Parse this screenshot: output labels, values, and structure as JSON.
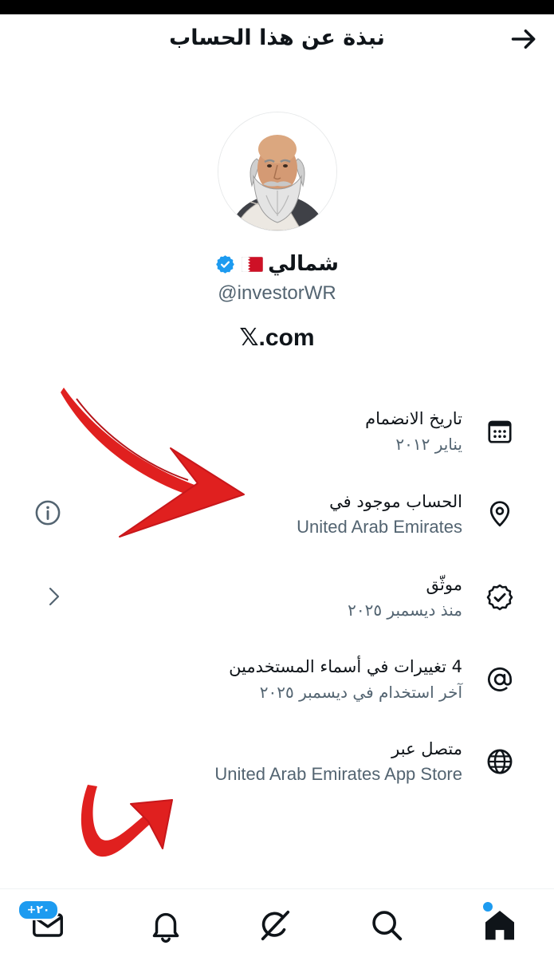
{
  "header": {
    "title": "نبذة عن هذا الحساب",
    "back_icon": "arrow-right-icon"
  },
  "profile": {
    "avatar_icon": "socrates-avatar-image",
    "name": "شمالي",
    "flag_icon": "bahrain-flag-icon",
    "verified_icon": "verified-badge-icon",
    "handle": "@investorWR",
    "website": "𝕏.com"
  },
  "details": [
    {
      "icon": "calendar-icon",
      "title": "تاريخ الانضمام",
      "subtitle": "يناير ٢٠١٢"
    },
    {
      "icon": "location-pin-icon",
      "title": "الحساب موجود في",
      "subtitle": "United Arab Emirates",
      "action_icon": "info-icon"
    },
    {
      "icon": "verified-outline-icon",
      "title": "موثّق",
      "subtitle": "منذ ديسمبر ٢٠٢٥",
      "action_icon": "chevron-right-icon"
    },
    {
      "icon": "at-sign-icon",
      "title": "4 تغييرات في أسماء المستخدمين",
      "subtitle": "آخر استخدام في ديسمبر ٢٠٢٥"
    },
    {
      "icon": "globe-icon",
      "title": "متصل عبر",
      "subtitle": "United Arab Emirates App Store"
    }
  ],
  "bottom_nav": {
    "home": {
      "icon": "home-icon",
      "active": true,
      "indicator": "blue-dot"
    },
    "search": {
      "icon": "search-icon"
    },
    "grok": {
      "icon": "grok-icon"
    },
    "notifications": {
      "icon": "bell-icon"
    },
    "messages": {
      "icon": "mail-icon",
      "badge": "+٢٠"
    }
  },
  "annotations": {
    "arrow_1_icon": "red-arrow-annotation",
    "arrow_2_icon": "red-curved-arrow-annotation"
  },
  "colors": {
    "accent": "#1d9bf0",
    "text": "#0f1419",
    "muted": "#536471",
    "annotation": "#e0201f",
    "flag_red": "#ce1126"
  }
}
